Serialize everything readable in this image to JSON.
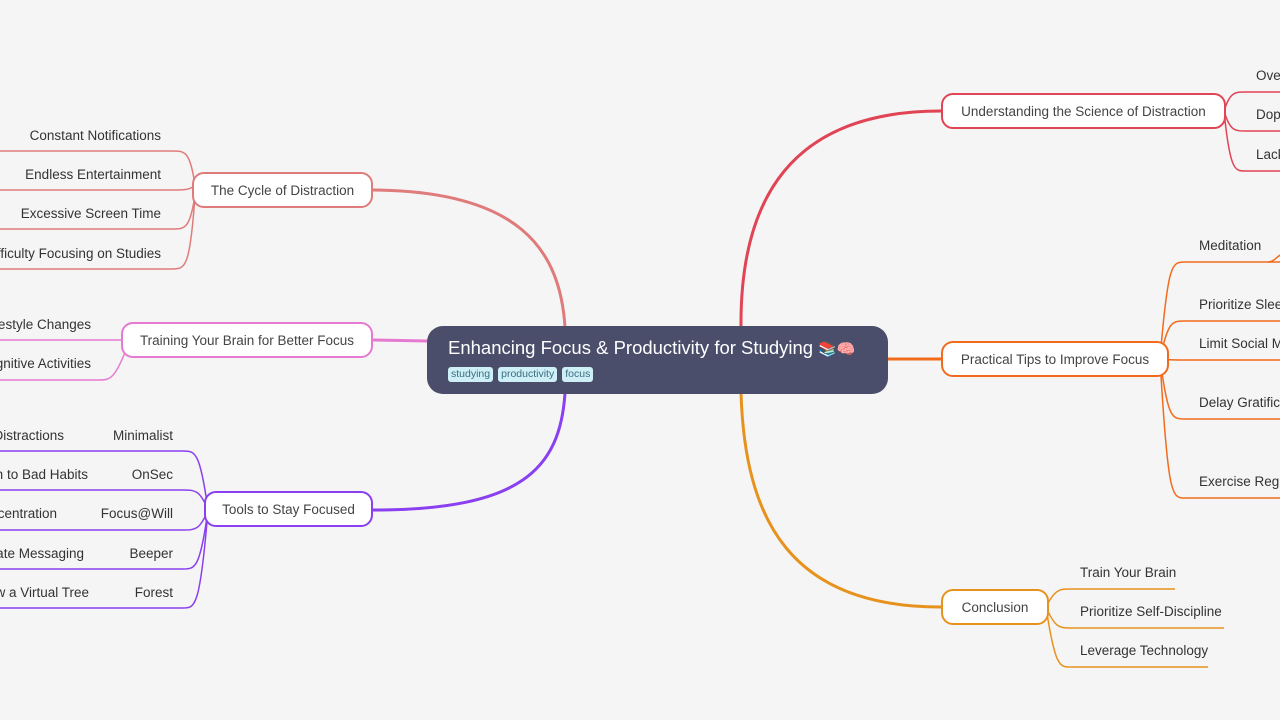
{
  "root": {
    "title": "Enhancing Focus & Productivity for Studying",
    "emoji": "📚🧠",
    "tags": [
      "studying",
      "productivity",
      "focus"
    ]
  },
  "colors": {
    "background": "#f5f5f5",
    "root": "#4b4e6b",
    "cycle": "#e07b7b",
    "training": "#e67ad0",
    "tools": "#8a3ff0",
    "science": "#e04455",
    "tips": "#f26b1d",
    "conclusion": "#e8921e"
  },
  "branches": {
    "cycle": {
      "label": "The Cycle of Distraction",
      "children": [
        "Constant Notifications",
        "Endless Entertainment",
        "Excessive Screen Time",
        "Difficulty Focusing on Studies"
      ]
    },
    "training": {
      "label": "Training Your Brain for Better Focus",
      "children": [
        "Lifestyle Changes",
        "Cognitive Activities"
      ]
    },
    "tools": {
      "label": "Tools to Stay Focused",
      "children": [
        {
          "name": "Minimalist",
          "detail": "Reduce Distractions"
        },
        {
          "name": "OnSec",
          "detail": "Lock Down to Bad Habits"
        },
        {
          "name": "Focus@Will",
          "detail": "Boost Concentration"
        },
        {
          "name": "Beeper",
          "detail": "Consolidate Messaging"
        },
        {
          "name": "Forest",
          "detail": "Grow a Virtual Tree"
        }
      ]
    },
    "science": {
      "label": "Understanding the Science of Distraction",
      "children": [
        "Overstimulation",
        "Dopamine",
        "Lack of Focus"
      ]
    },
    "tips": {
      "label": "Practical Tips to Improve Focus",
      "children": [
        "Meditation",
        "Prioritize Sleep",
        "Limit Social Media",
        "Delay Gratification",
        "Exercise Regularly"
      ]
    },
    "conclusion": {
      "label": "Conclusion",
      "children": [
        "Train Your Brain",
        "Prioritize Self-Discipline",
        "Leverage Technology"
      ]
    }
  }
}
